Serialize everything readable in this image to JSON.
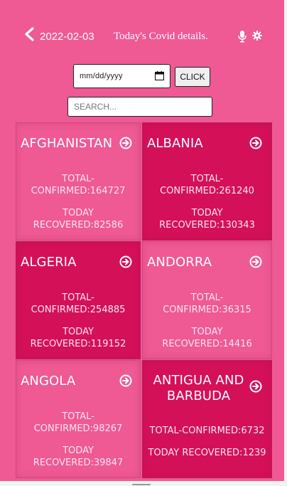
{
  "header": {
    "date": "2022-02-03",
    "title": "Today's Covid details."
  },
  "controls": {
    "date_placeholder": "mm/dd/yyyy",
    "click_label": "CLICK",
    "search_placeholder": "SEARCH..."
  },
  "labels": {
    "total_a": "TOTAL-",
    "total_b": "CONFIRMED:",
    "recovered_a": "TODAY",
    "recovered_b": "RECOVERED:",
    "total_inline": "TOTAL-CONFIRMED:",
    "recovered_inline": "TODAY RECOVERED:"
  },
  "countries": [
    {
      "name": "AFGHANISTAN",
      "confirmed": "164727",
      "recovered": "82586"
    },
    {
      "name": "ALBANIA",
      "confirmed": "261240",
      "recovered": "130343"
    },
    {
      "name": "ALGERIA",
      "confirmed": "254885",
      "recovered": "119152"
    },
    {
      "name": "ANDORRA",
      "confirmed": "36315",
      "recovered": "14416"
    },
    {
      "name": "ANGOLA",
      "confirmed": "98267",
      "recovered": "39847"
    },
    {
      "name": "ANTIGUA AND BARBUDA",
      "confirmed": "6732",
      "recovered": "1239"
    }
  ],
  "colors": {
    "background": "#ef5994",
    "card_light": "#ef5994",
    "card_dark": "#d41059",
    "text": "#ffffff"
  },
  "icons": {
    "back": "chevron-left-icon",
    "mic": "microphone-icon",
    "settings": "gear-icon",
    "calendar": "calendar-icon",
    "card_arrow": "arrow-right-circle-icon"
  }
}
